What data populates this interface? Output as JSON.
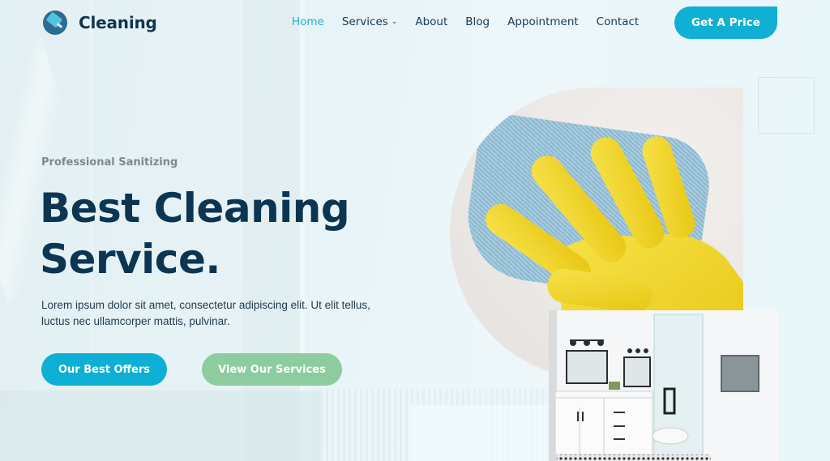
{
  "brand": {
    "name": "Cleaning",
    "logo_icon": "sponge-icon"
  },
  "nav": {
    "items": [
      {
        "label": "Home",
        "active": true
      },
      {
        "label": "Services",
        "has_dropdown": true,
        "caret": "⌄"
      },
      {
        "label": "About"
      },
      {
        "label": "Blog"
      },
      {
        "label": "Appointment"
      },
      {
        "label": "Contact"
      }
    ],
    "cta_label": "Get A Price"
  },
  "hero": {
    "eyebrow": "Professional Sanitizing",
    "title_line1": "Best Cleaning",
    "title_line2": "Service.",
    "description": "Lorem ipsum dolor sit amet, consectetur adipiscing elit. Ut elit tellus, luctus nec ullamcorper mattis, pulvinar.",
    "primary_button": "Our Best Offers",
    "secondary_button": "View Our Services"
  },
  "images": {
    "main": "yellow-glove-wiping-with-blue-cloth",
    "secondary": "bright-white-bathroom-with-glass-shower"
  },
  "colors": {
    "primary": "#0db0d4",
    "secondary": "#8ccc9e",
    "heading": "#0c3552",
    "nav_active": "#1fb0cf"
  }
}
